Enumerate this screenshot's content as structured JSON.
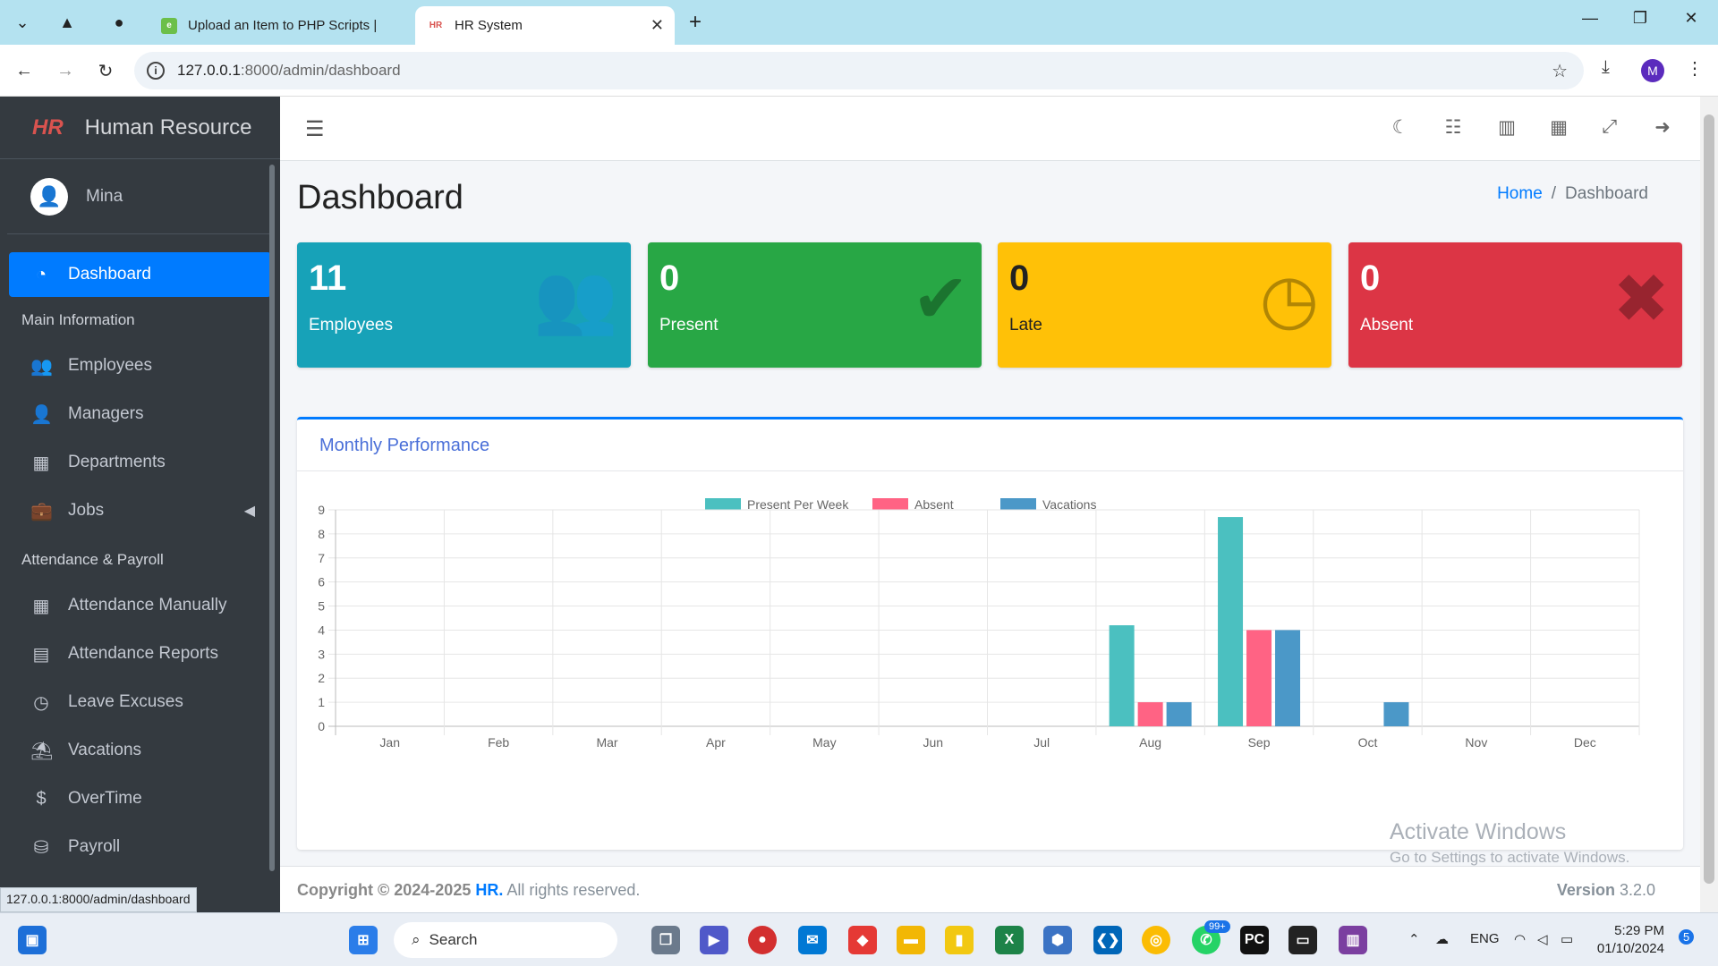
{
  "browser": {
    "tabs": [
      {
        "label": "Upload an Item to PHP Scripts |",
        "active": false
      },
      {
        "label": "HR System",
        "active": true
      }
    ],
    "url_host": "127.0.0.1",
    "url_path": ":8000/admin/dashboard",
    "profile_initial": "M",
    "status_url": "127.0.0.1:8000/admin/dashboard"
  },
  "sidebar": {
    "brand": "Human Resource",
    "brand_logo": "HR",
    "user_name": "Mina",
    "items": [
      {
        "label": "Dashboard",
        "icon": "tachometer-icon"
      },
      {
        "header": "Main Information"
      },
      {
        "label": "Employees",
        "icon": "users-icon"
      },
      {
        "label": "Managers",
        "icon": "user-icon"
      },
      {
        "label": "Departments",
        "icon": "building-icon"
      },
      {
        "label": "Jobs",
        "icon": "briefcase-icon"
      },
      {
        "header": "Attendance & Payroll"
      },
      {
        "label": "Attendance Manually",
        "icon": "calendar-icon"
      },
      {
        "label": "Attendance Reports",
        "icon": "file-icon"
      },
      {
        "label": "Leave Excuses",
        "icon": "clock-icon"
      },
      {
        "label": "Vacations",
        "icon": "umbrella-beach-icon"
      },
      {
        "label": "OverTime",
        "icon": "dollar-icon"
      },
      {
        "label": "Payroll",
        "icon": "coins-icon"
      }
    ]
  },
  "header": {
    "page_title": "Dashboard",
    "breadcrumb_home": "Home",
    "breadcrumb_current": "Dashboard"
  },
  "stats": [
    {
      "value": "11",
      "label": "Employees",
      "color": "#17a2b8",
      "icon": "users-icon"
    },
    {
      "value": "0",
      "label": "Present",
      "color": "#28a745",
      "icon": "check-icon"
    },
    {
      "value": "0",
      "label": "Late",
      "color": "#ffc107",
      "icon": "clock-icon"
    },
    {
      "value": "0",
      "label": "Absent",
      "color": "#dc3545",
      "icon": "times-icon"
    }
  ],
  "card": {
    "title": "Monthly Performance"
  },
  "chart_data": {
    "type": "bar",
    "categories": [
      "Jan",
      "Feb",
      "Mar",
      "Apr",
      "May",
      "Jun",
      "Jul",
      "Aug",
      "Sep",
      "Oct",
      "Nov",
      "Dec"
    ],
    "series": [
      {
        "name": "Present Per Week",
        "color": "#4bc0c0",
        "values": [
          0,
          0,
          0,
          0,
          0,
          0,
          0,
          4.2,
          8.7,
          0,
          0,
          0
        ]
      },
      {
        "name": "Absent",
        "color": "#ff6384",
        "values": [
          0,
          0,
          0,
          0,
          0,
          0,
          0,
          1,
          4,
          0,
          0,
          0
        ]
      },
      {
        "name": "Vacations",
        "color": "#4b98c8",
        "values": [
          0,
          0,
          0,
          0,
          0,
          0,
          0,
          1,
          4,
          1,
          0,
          0
        ]
      }
    ],
    "ylim": [
      0,
      9
    ],
    "yticks": [
      0,
      1,
      2,
      3,
      4,
      5,
      6,
      7,
      8,
      9
    ],
    "grid": true,
    "legend": "top-center"
  },
  "watermark": {
    "line1": "Activate Windows",
    "line2": "Go to Settings to activate Windows."
  },
  "footer": {
    "copyright_prefix": "Copyright © 2024-2025 ",
    "brand": "HR.",
    "suffix": " All rights reserved.",
    "version_label": "Version",
    "version": "3.2.0"
  },
  "taskbar": {
    "search_label": "Search",
    "lang": "ENG",
    "time": "5:29 PM",
    "date": "01/10/2024",
    "notif_count": "5",
    "whatsapp_badge": "99+"
  }
}
